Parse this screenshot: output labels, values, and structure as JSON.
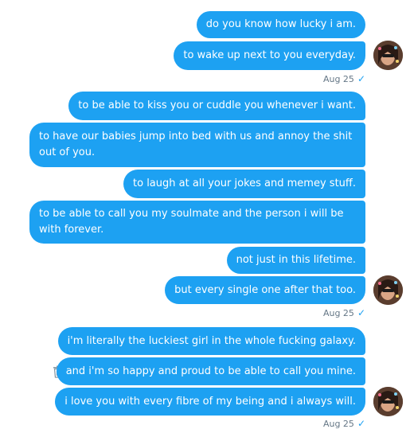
{
  "messages": [
    {
      "text": "do you know how lucky i am."
    },
    {
      "text": "to wake up next to you everyday."
    },
    {
      "text": "to be able to kiss you or cuddle you whenever i want."
    },
    {
      "text": "to have our babies jump into bed with us and annoy the shit out of you."
    },
    {
      "text": "to laugh at all your jokes and memey stuff."
    },
    {
      "text": "to be able to call you my soulmate and the person i will be with forever."
    },
    {
      "text": "not just in this lifetime."
    },
    {
      "text": "but every single one after that too."
    },
    {
      "text": "i'm literally the luckiest girl in the whole fucking galaxy."
    },
    {
      "text": "and i'm so happy and proud to be able to call you mine."
    },
    {
      "text": "i love you with every fibre of my being and i always will."
    }
  ],
  "groups": [
    {
      "timestamp": "Aug 25",
      "status_icon": "read-check-icon"
    },
    {
      "timestamp": "Aug 25",
      "status_icon": "read-check-icon"
    },
    {
      "timestamp": "Aug 25",
      "status_icon": "read-check-icon"
    }
  ],
  "icons": {
    "check_glyph": "✓",
    "trash": "trash-icon",
    "avatar": "avatar"
  },
  "colors": {
    "bubble": "#1da1f2",
    "bubble_text": "#ffffff",
    "timestamp": "#657786",
    "check": "#1da1f2",
    "trash": "#8899a6"
  }
}
